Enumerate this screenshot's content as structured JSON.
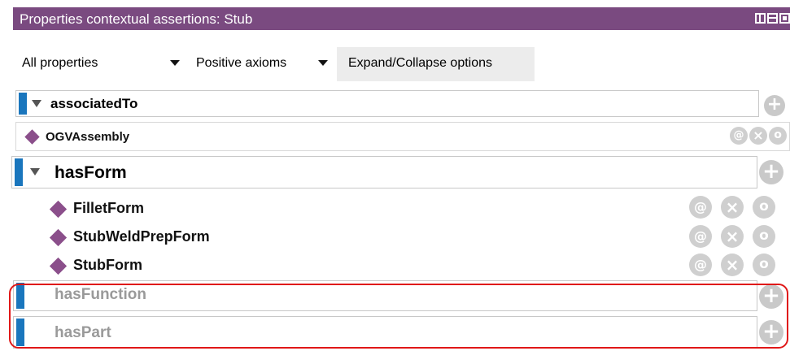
{
  "window": {
    "title": "Properties contextual assertions: Stub",
    "view_icons": [
      "columns-view-icon",
      "rows-view-icon",
      "single-view-icon"
    ]
  },
  "toolbar": {
    "property_filter": "All properties",
    "axiom_filter": "Positive axioms",
    "expand_button": "Expand/Collapse options"
  },
  "properties": [
    {
      "name": "associatedTo",
      "expanded": true,
      "dimmed": false,
      "entries": [
        "OGVAssembly"
      ]
    },
    {
      "name": "hasForm",
      "expanded": true,
      "dimmed": false,
      "entries": [
        "FilletForm",
        "StubWeldPrepForm",
        "StubForm"
      ]
    },
    {
      "name": "hasFunction",
      "expanded": false,
      "dimmed": true,
      "entries": []
    },
    {
      "name": "hasPart",
      "expanded": false,
      "dimmed": true,
      "entries": []
    }
  ],
  "entry_actions": {
    "annotate": "@",
    "delete": "×",
    "edit": "o"
  },
  "colors": {
    "titlebar": "#7a4a80",
    "marker": "#1a76bd",
    "diamond": "#8b4f8b",
    "highlight": "#e01818"
  }
}
